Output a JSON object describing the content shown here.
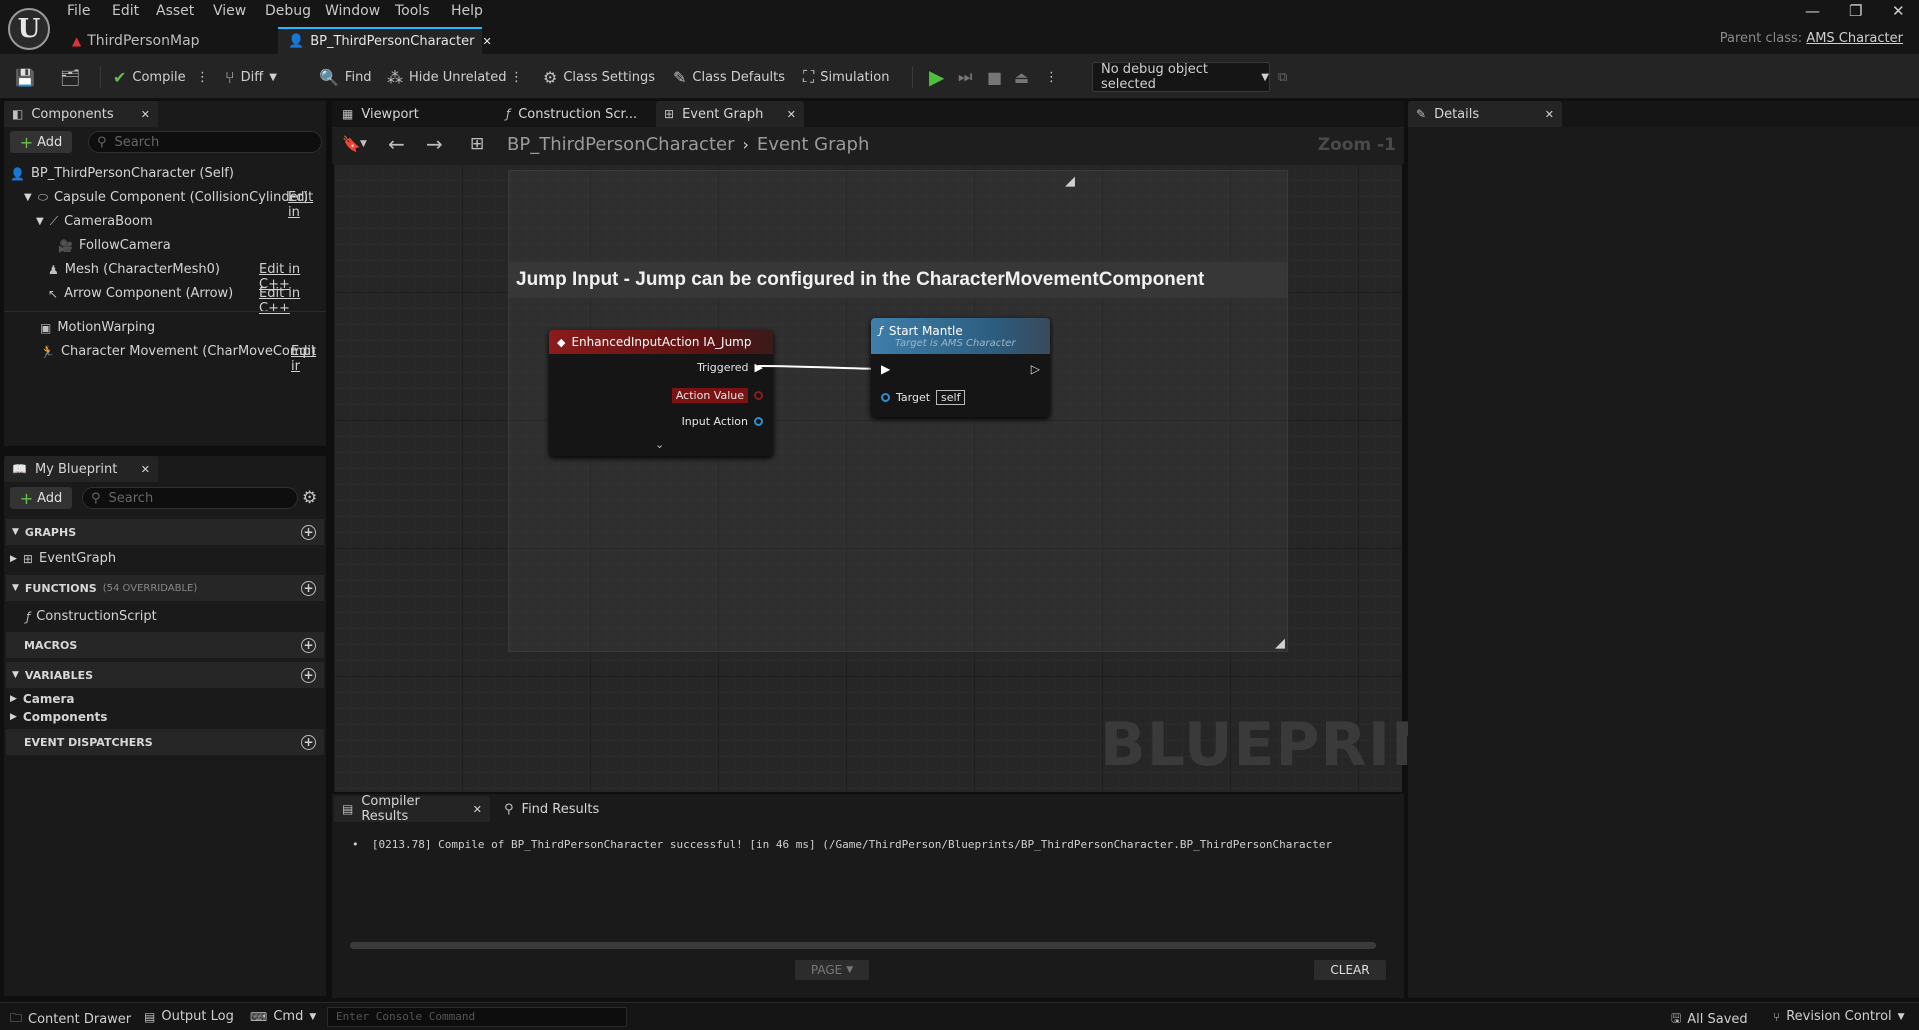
{
  "menu": [
    "File",
    "Edit",
    "Asset",
    "View",
    "Debug",
    "Window",
    "Tools",
    "Help"
  ],
  "doc_tabs": {
    "map": "ThirdPersonMap",
    "blueprint": "BP_ThirdPersonCharacter"
  },
  "parent_class": {
    "label": "Parent class:",
    "value": "AMS Character"
  },
  "toolbar": {
    "compile": "Compile",
    "diff": "Diff",
    "find": "Find",
    "hide_unrelated": "Hide Unrelated",
    "class_settings": "Class Settings",
    "class_defaults": "Class Defaults",
    "simulation": "Simulation",
    "debug_object": "No debug object selected"
  },
  "components": {
    "tab": "Components",
    "add": "Add",
    "search_placeholder": "Search",
    "self": "BP_ThirdPersonCharacter (Self)",
    "items": [
      {
        "label": "Capsule Component (CollisionCylinder)",
        "edit": "Edit in"
      },
      {
        "label": "CameraBoom",
        "edit": ""
      },
      {
        "label": "FollowCamera",
        "edit": ""
      },
      {
        "label": "Mesh (CharacterMesh0)",
        "edit": "Edit in C++"
      },
      {
        "label": "Arrow Component (Arrow)",
        "edit": "Edit in C++"
      },
      {
        "label": "MotionWarping",
        "edit": ""
      },
      {
        "label": "Character Movement (CharMoveComp)",
        "edit": "Edit ir"
      }
    ]
  },
  "my_blueprint": {
    "tab": "My Blueprint",
    "add": "Add",
    "search_placeholder": "Search",
    "graphs": "GRAPHS",
    "event_graph": "EventGraph",
    "functions": "FUNCTIONS",
    "functions_count": "(54 OVERRIDABLE)",
    "construction_script": "ConstructionScript",
    "macros": "MACROS",
    "variables": "VARIABLES",
    "var_camera": "Camera",
    "var_components": "Components",
    "event_dispatchers": "EVENT DISPATCHERS"
  },
  "editor_tabs": {
    "viewport": "Viewport",
    "construction": "Construction Scr...",
    "event_graph": "Event Graph"
  },
  "breadcrumb": {
    "root": "BP_ThirdPersonCharacter",
    "current": "Event Graph",
    "zoom": "Zoom -1"
  },
  "comment": "Jump Input - Jump can be configured in the CharacterMovementComponent",
  "node_input": {
    "title": "EnhancedInputAction IA_Jump",
    "pins": [
      "Triggered",
      "Action Value",
      "Input Action"
    ]
  },
  "node_mantle": {
    "title": "Start Mantle",
    "subtitle": "Target is AMS Character",
    "target_label": "Target",
    "target_value": "self"
  },
  "watermark": "BLUEPRINT",
  "details": {
    "tab": "Details"
  },
  "results": {
    "compiler_tab": "Compiler Results",
    "find_tab": "Find Results",
    "log": "[0213.78] Compile of BP_ThirdPersonCharacter successful! [in 46 ms] (/Game/ThirdPerson/Blueprints/BP_ThirdPersonCharacter.BP_ThirdPersonCharacter",
    "page": "PAGE",
    "clear": "CLEAR"
  },
  "status": {
    "content_drawer": "Content Drawer",
    "output_log": "Output Log",
    "cmd": "Cmd",
    "console_placeholder": "Enter Console Command",
    "all_saved": "All Saved",
    "revision_control": "Revision Control"
  }
}
